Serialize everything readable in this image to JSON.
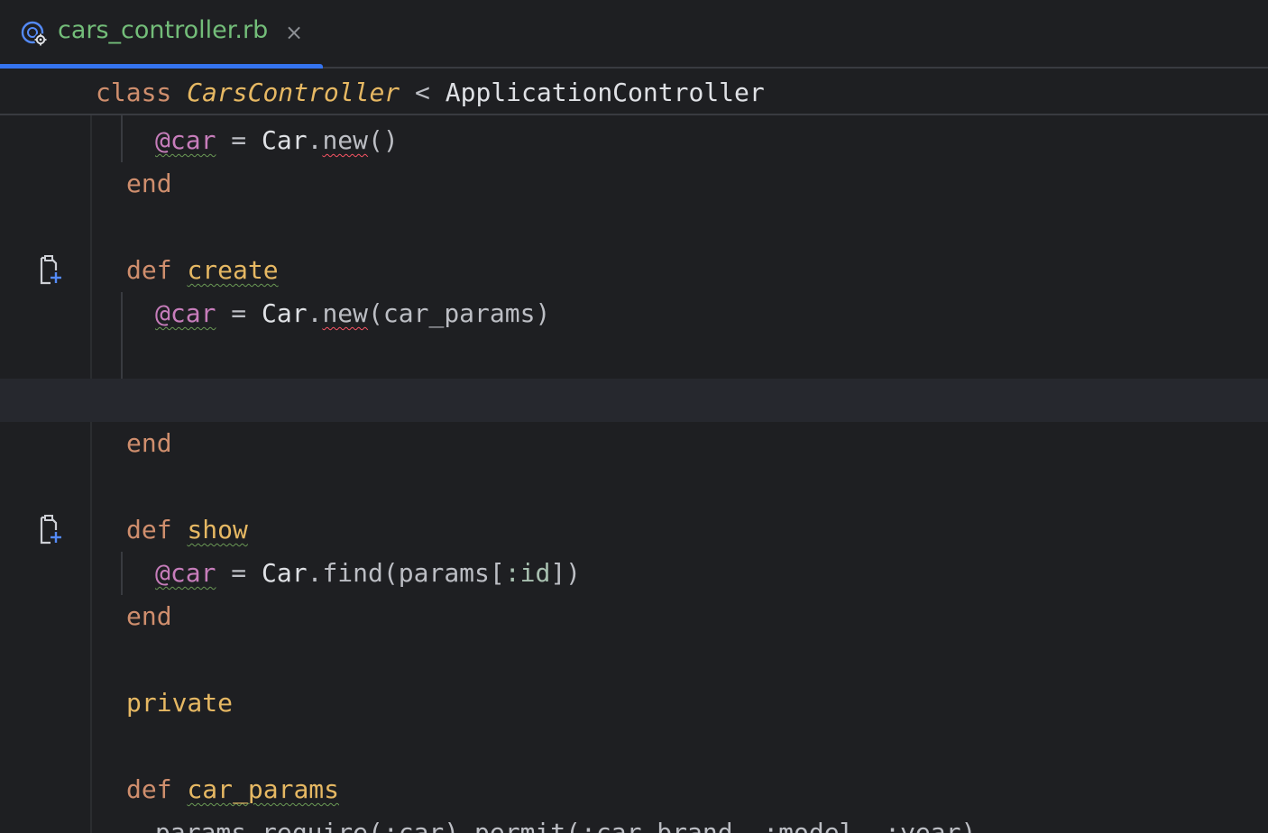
{
  "tab": {
    "filename": "cars_controller.rb",
    "close_glyph": "×",
    "icon": "ruby-controller-icon",
    "accent": "#3574f0",
    "label_color": "#73bd79"
  },
  "sticky": {
    "keyword": "class",
    "class_name": "CarsController",
    "lt": "<",
    "parent": "ApplicationController"
  },
  "lines": {
    "l1": {
      "ivar": "@car",
      "eq": " = ",
      "const": "Car",
      "dot": ".",
      "method": "new",
      "rest": "()"
    },
    "l2": {
      "kw": "end"
    },
    "l4": {
      "kw": "def",
      "name": "create"
    },
    "l5": {
      "ivar": "@car",
      "eq": " = ",
      "const": "Car",
      "dot": ".",
      "method": "new",
      "rest": "(car_params)"
    },
    "l8": {
      "kw": "end"
    },
    "l10": {
      "kw": "def",
      "name": "show"
    },
    "l11": {
      "ivar": "@car",
      "eq": " = ",
      "const": "Car",
      "dot": ".",
      "method": "find",
      "open": "(params[",
      "sym": ":id",
      "close": "])"
    },
    "l12": {
      "kw": "end"
    },
    "l14": {
      "kw": "private"
    },
    "l16": {
      "kw": "def",
      "name": "car_params"
    },
    "l17": {
      "text": "params.require(:car).permit(:car_brand, :model, :year)"
    }
  },
  "gutter_icons": [
    "add-test-file-icon",
    "add-test-file-icon"
  ]
}
